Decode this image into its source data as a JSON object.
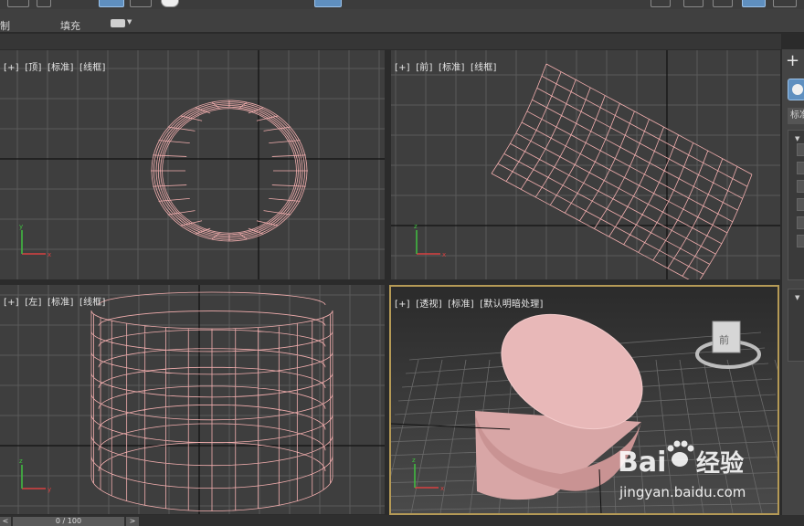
{
  "colors": {
    "viewport_bg": "#3e3e3e",
    "grid_line": "#5a5a5a",
    "axis_line": "#111111",
    "wireframe": "#f2aeae",
    "active_border": "#b59a56",
    "solid_top": "#e8b8b8",
    "solid_side": "#d8a6a6",
    "accent": "#5f8fbf"
  },
  "ribbon": {
    "tab_draw": "制",
    "tab_fill": "填充"
  },
  "viewports": {
    "top": {
      "tokens": [
        "[+]",
        "[顶]",
        "[标准]",
        "[线框]"
      ]
    },
    "front": {
      "tokens": [
        "[+]",
        "[前]",
        "[标准]",
        "[线框]"
      ]
    },
    "left": {
      "tokens": [
        "[+]",
        "[左]",
        "[标准]",
        "[线框]"
      ]
    },
    "perspective": {
      "tokens": [
        "[+]",
        "[透视]",
        "[标准]",
        "[默认明暗处理]"
      ]
    }
  },
  "viewcube": {
    "face_label": "前"
  },
  "command_panel": {
    "tab_label": "标准"
  },
  "timeline": {
    "frame_label": "0 / 100",
    "prev": "<",
    "next": ">"
  },
  "watermark": {
    "logo": "Bai😀经验",
    "url": "jingyan.baidu.com"
  }
}
